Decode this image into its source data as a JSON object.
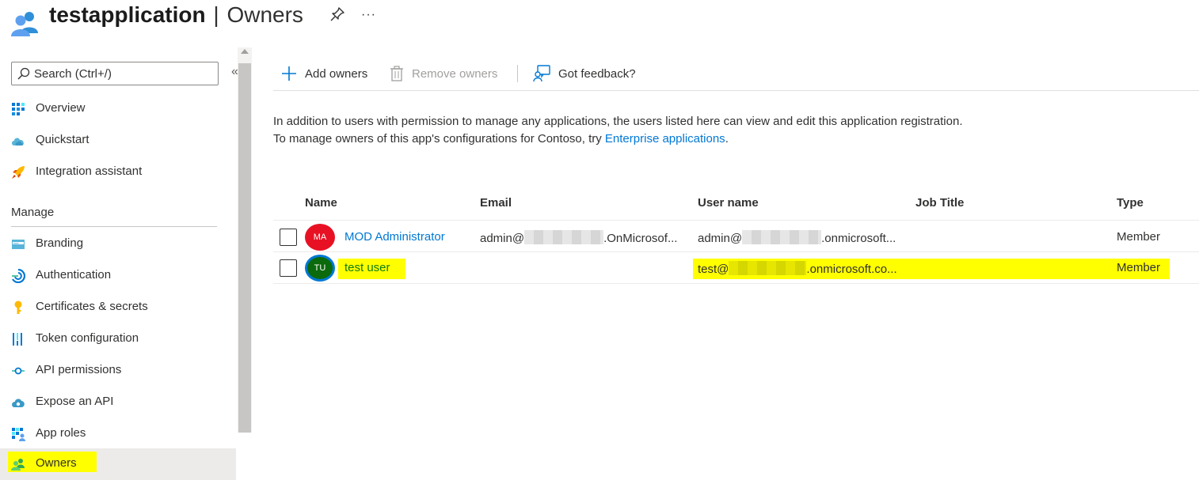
{
  "header": {
    "app_name": "testapplication",
    "separator": "|",
    "page_title": "Owners",
    "more": "···"
  },
  "sidebar": {
    "search_placeholder": "Search (Ctrl+/)",
    "collapse": "«",
    "items_top": [
      {
        "label": "Overview",
        "icon": "overview-grid-icon"
      },
      {
        "label": "Quickstart",
        "icon": "cloud-icon"
      },
      {
        "label": "Integration assistant",
        "icon": "rocket-icon"
      }
    ],
    "section_label": "Manage",
    "items_manage": [
      {
        "label": "Branding",
        "icon": "branding-icon"
      },
      {
        "label": "Authentication",
        "icon": "authentication-icon"
      },
      {
        "label": "Certificates & secrets",
        "icon": "key-icon"
      },
      {
        "label": "Token configuration",
        "icon": "token-bars-icon"
      },
      {
        "label": "API permissions",
        "icon": "api-permissions-icon"
      },
      {
        "label": "Expose an API",
        "icon": "cloud-gear-icon"
      },
      {
        "label": "App roles",
        "icon": "app-roles-grid-icon"
      },
      {
        "label": "Owners",
        "icon": "owners-people-icon",
        "active": true
      }
    ]
  },
  "toolbar": {
    "add_label": "Add owners",
    "remove_label": "Remove owners",
    "feedback_label": "Got feedback?"
  },
  "description": {
    "line1": "In addition to users with permission to manage any applications, the users listed here can view and edit this application registration.",
    "line2_prefix": "To manage owners of this app's configurations for Contoso, try ",
    "line2_link": "Enterprise applications",
    "line2_suffix": "."
  },
  "table": {
    "columns": [
      "Name",
      "Email",
      "User name",
      "Job Title",
      "Type"
    ],
    "rows": [
      {
        "initials": "MA",
        "avatar_color": "#e81123",
        "name": "MOD Administrator",
        "email_prefix": "admin@",
        "email_suffix": ".OnMicrosof...",
        "username_prefix": "admin@",
        "username_suffix": ".onmicrosoft...",
        "job_title": "",
        "type": "Member"
      },
      {
        "initials": "TU",
        "avatar_color": "#0b6a0b",
        "avatar_ring": "#0078d4",
        "name": "test user",
        "email_prefix": "",
        "email_suffix": "",
        "username_prefix": "test@",
        "username_suffix": ".onmicrosoft.co...",
        "job_title": "",
        "type": "Member",
        "highlighted": true
      }
    ]
  },
  "colors": {
    "accent": "#0078d4",
    "highlight": "#ffff00"
  }
}
